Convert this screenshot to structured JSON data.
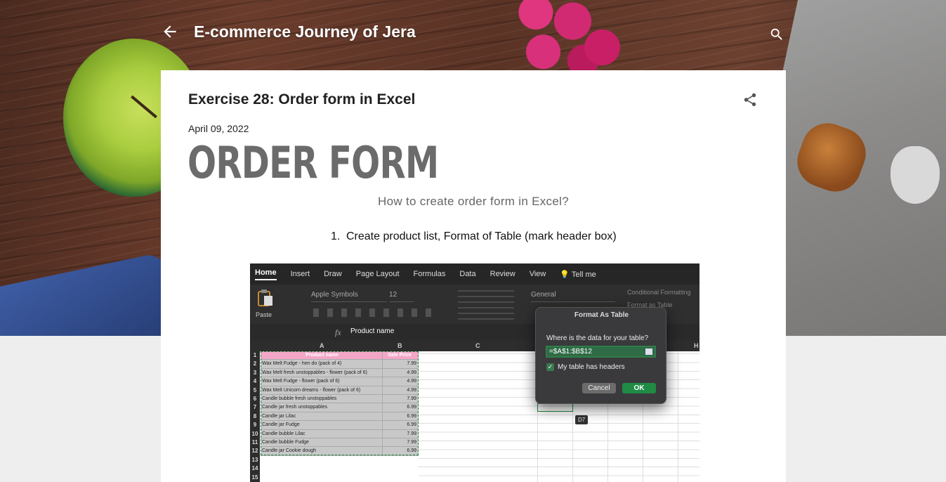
{
  "header": {
    "blog_title": "E-commerce Journey of Jera"
  },
  "icons": {
    "back": "arrow-left-icon",
    "search": "search-icon",
    "share": "share-icon"
  },
  "post": {
    "title": "Exercise 28: Order form in Excel",
    "date": "April 09, 2022",
    "big_heading": "ORDER FORM",
    "subtitle": "How to create order form in Excel?",
    "steps": [
      {
        "number": "1.",
        "text": "Create product list, Format of Table (mark header box)"
      }
    ]
  },
  "excel": {
    "tabs": [
      "Home",
      "Insert",
      "Draw",
      "Page Layout",
      "Formulas",
      "Data",
      "Review",
      "View",
      "💡 Tell me"
    ],
    "paste_label": "Paste",
    "font_name": "Apple Symbols",
    "font_size": "12",
    "number_format": "General",
    "conditional_formatting": "Conditional Formatting",
    "format_as_table": "Format as Table",
    "formula_value": "Product name",
    "columns": [
      "A",
      "B",
      "C",
      "H"
    ],
    "headers": {
      "a": "Product name",
      "b": "Sale Price"
    },
    "rows": [
      {
        "n": "2",
        "name": "Wax Melt Fudge - hen do (pack of 4)",
        "price": "7.99"
      },
      {
        "n": "3",
        "name": "Wax Melt fresh unstoppables - flower (pack of 6)",
        "price": "4.99"
      },
      {
        "n": "4",
        "name": "Wax Melt Fudge - flower (pack of 6)",
        "price": "4.99"
      },
      {
        "n": "5",
        "name": "Wax Melt Unicorn dreams - flower (pack of 6)",
        "price": "4.99"
      },
      {
        "n": "6",
        "name": "Candle bubble fresh unstoppables",
        "price": "7.99"
      },
      {
        "n": "7",
        "name": "Candle jar fresh unstoppables",
        "price": "6.99"
      },
      {
        "n": "8",
        "name": "Candle jar Lilac",
        "price": "6.99"
      },
      {
        "n": "9",
        "name": "Candle jar Fudge",
        "price": "6.99"
      },
      {
        "n": "10",
        "name": "Candle bubble Lilac",
        "price": "7.99"
      },
      {
        "n": "11",
        "name": "Candle bubble Fudge",
        "price": "7.99"
      },
      {
        "n": "12",
        "name": "Candle jar Cookie dough",
        "price": "6.99"
      }
    ],
    "empty_rows": [
      "13",
      "14",
      "15"
    ],
    "dialog": {
      "title": "Format As Table",
      "question": "Where is the data for your table?",
      "range": "=$A$1:$B$12",
      "checkbox_label": "My table has headers",
      "cancel": "Cancel",
      "ok": "OK"
    },
    "cell_ref": "D7"
  }
}
